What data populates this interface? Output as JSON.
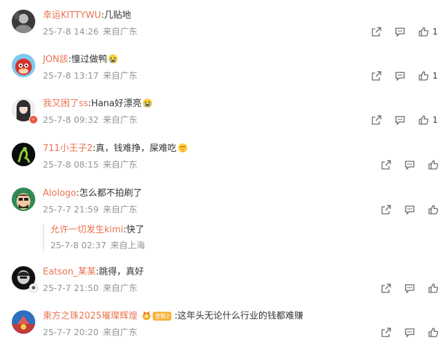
{
  "comments": [
    {
      "user": "幸运KITTYWU",
      "text": "几贴地",
      "emoji": "",
      "time": "25-7-8 14:26",
      "location": "来自广东",
      "likes": "1"
    },
    {
      "user": "JON該",
      "text": "憧过做鸭",
      "emoji": "sob-emoji",
      "time": "25-7-8 13:17",
      "location": "来自广东",
      "likes": "1"
    },
    {
      "user": "我又困了ss",
      "text": "Hana好漂亮",
      "emoji": "sob-emoji",
      "time": "25-7-8 09:32",
      "location": "来自广东",
      "likes": "1"
    },
    {
      "user": "711小王子2",
      "text": "真，钱难挣，屎难吃",
      "emoji": "shh-emoji",
      "time": "25-7-8 08:15",
      "location": "来自广东",
      "likes": ""
    },
    {
      "user": "Alologo",
      "text": "怎么都不拍刷了",
      "emoji": "",
      "time": "25-7-7 21:59",
      "location": "来自广东",
      "likes": ""
    },
    {
      "user": "Eatson_某某",
      "text": "跳得，真好",
      "emoji": "",
      "time": "25-7-7 21:50",
      "location": "来自广东",
      "likes": ""
    },
    {
      "user": "東方之珠2025璀璨辉煌",
      "text": "这年头无论什么行业的钱都难赚",
      "emoji": "",
      "fan_badge": "金粉2",
      "time": "25-7-7 20:20",
      "location": "来自广东",
      "likes": ""
    }
  ],
  "reply": {
    "user": "允许一切发生kimi",
    "text": "快了",
    "time": "25-7-8 02:37",
    "location": "来自上海"
  },
  "colon": ":",
  "colors": {
    "username": "#eb7350",
    "meta": "#939393",
    "text": "#333333",
    "icon": "#666666"
  }
}
